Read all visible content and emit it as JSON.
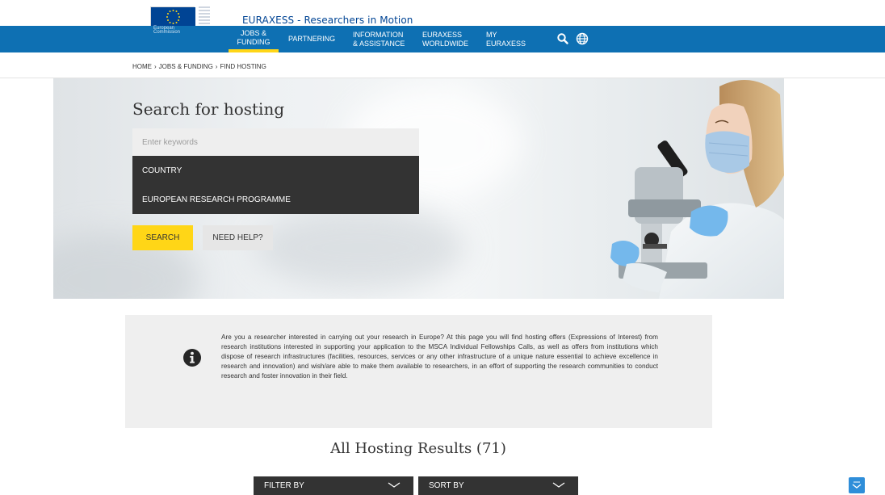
{
  "header": {
    "site_title": "EURAXESS - Researchers in Motion",
    "logo_caption": "European Commission",
    "colors": {
      "nav_bg": "#0e70b3",
      "accent": "#ffd617",
      "logo_blue": "#004494"
    }
  },
  "nav": {
    "items": [
      {
        "line1": "JOBS &",
        "line2": "FUNDING",
        "active": true
      },
      {
        "line1": "PARTNERING",
        "line2": "",
        "active": false
      },
      {
        "line1": "INFORMATION",
        "line2": "& ASSISTANCE",
        "active": false
      },
      {
        "line1": "EURAXESS",
        "line2": "WORLDWIDE",
        "active": false
      },
      {
        "line1": "MY",
        "line2": "EURAXESS",
        "active": false
      }
    ],
    "icons": [
      "search-icon",
      "globe-icon"
    ]
  },
  "breadcrumb": {
    "items": [
      "HOME",
      "JOBS & FUNDING",
      "FIND HOSTING"
    ],
    "separator": "›"
  },
  "search": {
    "title": "Search for hosting",
    "keywords_placeholder": "Enter keywords",
    "country_label": "COUNTRY",
    "programme_label": "EUROPEAN RESEARCH PROGRAMME",
    "search_button": "SEARCH",
    "help_button": "NEED HELP?"
  },
  "info": {
    "icon": "info-icon",
    "text": "Are you a researcher interested in carrying out your research in Europe? At this page you will find hosting offers (Expressions of Interest) from research institutions interested in supporting your application to the MSCA Individual Fellowships Calls, as well as offers from institutions which dispose of research infrastructures (facilities, resources, services or any other infrastructure of a unique nature essential to achieve excellence in research and innovation) and wish/are able to make them available to researchers, in an effort of supporting the research communities to conduct research and foster innovation in their field."
  },
  "results": {
    "title": "All Hosting Results (71)",
    "filter_label": "FILTER BY",
    "sort_label": "SORT BY"
  }
}
